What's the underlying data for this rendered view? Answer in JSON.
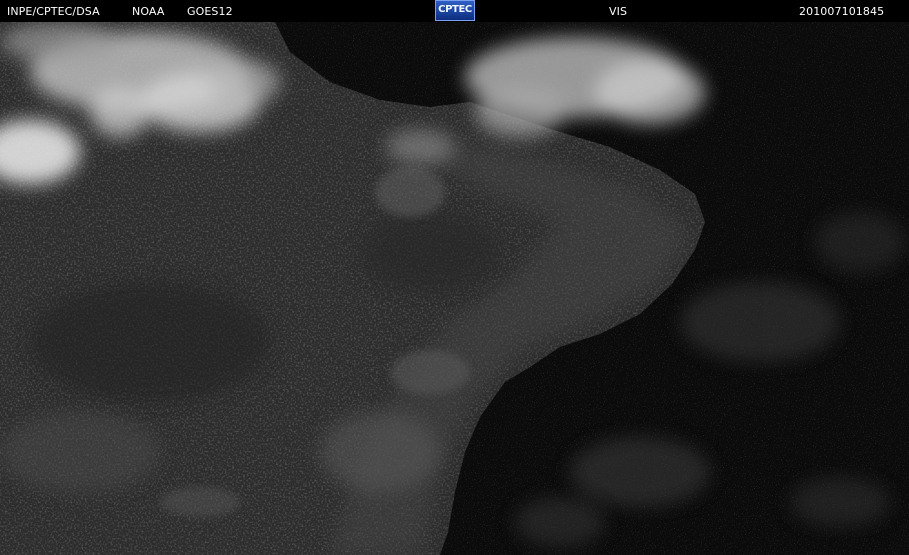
{
  "header": {
    "source": "INPE/CPTEC/DSA",
    "agency": "NOAA",
    "satellite": "GOES12",
    "logo_text": "CPTEC",
    "channel": "VIS",
    "timestamp": "201007101845"
  },
  "image": {
    "description_icon": "satellite-visible-image",
    "colors": {
      "background": "#000000",
      "land": "#2c2c2c",
      "ocean": "#0b0b0b",
      "cloud": "#e6e6e6",
      "logo": "#2a55b8"
    }
  }
}
